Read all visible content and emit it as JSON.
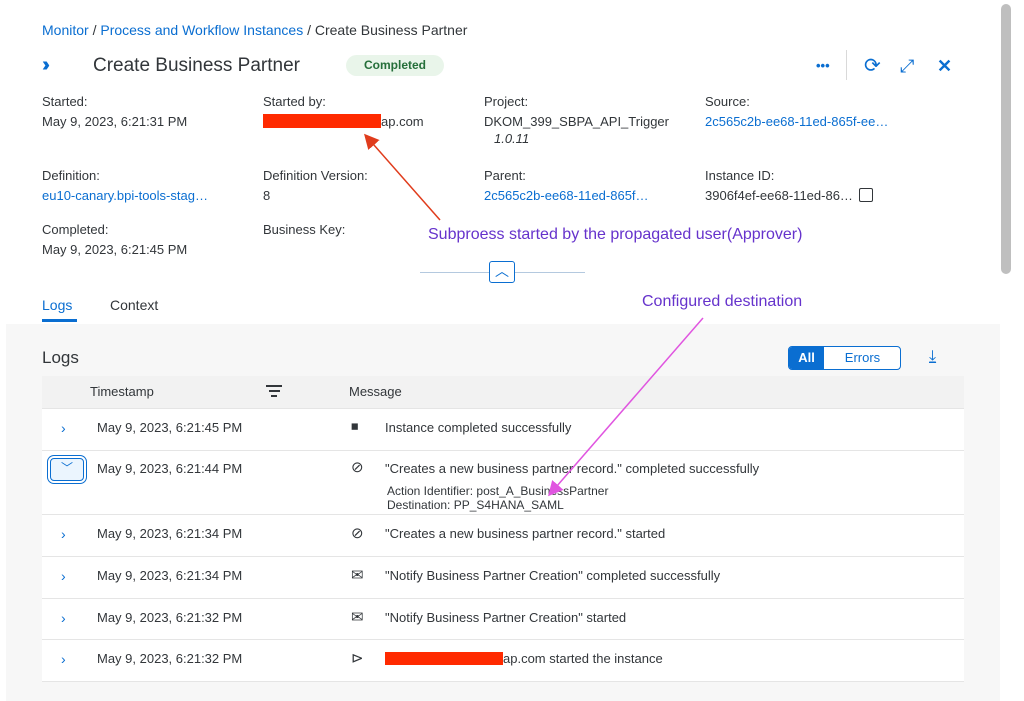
{
  "breadcrumb": {
    "monitor": "Monitor",
    "sep1": " / ",
    "instances": "Process and Workflow Instances",
    "sep2": " / ",
    "current": "Create Business Partner"
  },
  "header": {
    "title": "Create Business Partner",
    "status": "Completed",
    "actions": {
      "more": "•••",
      "refresh": "⟳",
      "fullscreen": "⤢",
      "close": "✕"
    }
  },
  "fields": {
    "started": {
      "label": "Started:",
      "value": "May 9, 2023, 6:21:31 PM"
    },
    "started_by": {
      "label": "Started by:",
      "value_suffix": "ap.com"
    },
    "project": {
      "label": "Project:",
      "value": "DKOM_399_SBPA_API_Trigger",
      "version": "1.0.11"
    },
    "source": {
      "label": "Source:",
      "value": "2c565c2b-ee68-11ed-865f-ee…"
    },
    "definition": {
      "label": "Definition:",
      "value": "eu10-canary.bpi-tools-stag…"
    },
    "definition_version": {
      "label": "Definition Version:",
      "value": "8"
    },
    "parent": {
      "label": "Parent:",
      "value": "2c565c2b-ee68-11ed-865f…"
    },
    "instance_id": {
      "label": "Instance ID:",
      "value": "3906f4ef-ee68-11ed-86…"
    },
    "completed": {
      "label": "Completed:",
      "value": "May 9, 2023, 6:21:45 PM"
    },
    "business_key": {
      "label": "Business Key:"
    }
  },
  "tabs": {
    "logs": "Logs",
    "context": "Context"
  },
  "logs": {
    "title": "Logs",
    "filter_all": "All",
    "filter_errors": "Errors",
    "columns": {
      "timestamp": "Timestamp",
      "message": "Message"
    },
    "rows": [
      {
        "timestamp": "May 9, 2023, 6:21:45 PM",
        "message": "Instance completed successfully",
        "icon": "stop-circle-icon"
      },
      {
        "timestamp": "May 9, 2023, 6:21:44 PM",
        "message": "\"Creates a new business partner record.\" completed successfully",
        "icon": "action-icon",
        "action_identifier_label": "Action Identifier:",
        "action_identifier_value": "post_A_BusinessPartner",
        "destination_label": "Destination:",
        "destination_value": "PP_S4HANA_SAML"
      },
      {
        "timestamp": "May 9, 2023, 6:21:34 PM",
        "message": "\"Creates a new business partner record.\" started",
        "icon": "action-icon"
      },
      {
        "timestamp": "May 9, 2023, 6:21:34 PM",
        "message": "\"Notify Business Partner Creation\" completed successfully",
        "icon": "mail-icon"
      },
      {
        "timestamp": "May 9, 2023, 6:21:32 PM",
        "message": "\"Notify Business Partner Creation\" started",
        "icon": "mail-icon"
      },
      {
        "timestamp": "May 9, 2023, 6:21:32 PM",
        "message_suffix": "ap.com started the instance",
        "icon": "play-circle-icon"
      }
    ]
  },
  "annotations": {
    "subprocess": "Subproess started by the propagated user(Approver)",
    "destination": "Configured destination"
  },
  "colors": {
    "accent": "#0a6ed1",
    "annotation": "#6633cc",
    "arrow_red": "#e03c1c",
    "arrow_pink": "#e055e0",
    "redaction": "#ff2a00"
  }
}
